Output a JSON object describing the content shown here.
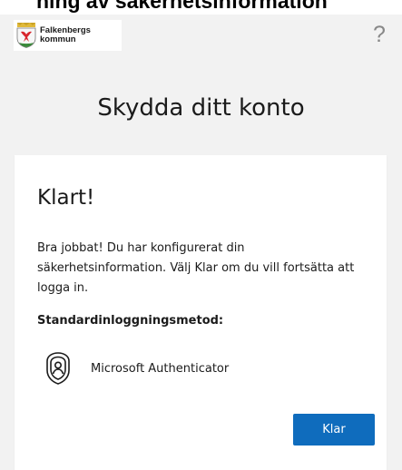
{
  "top_partial_text": "ning av säkerhetsinformation",
  "header": {
    "logo_line1": "Falkenbergs",
    "logo_line2": "kommun",
    "help_glyph": "?"
  },
  "page_title": "Skydda ditt konto",
  "card": {
    "heading": "Klart!",
    "description": "Bra jobbat! Du har konfigurerat din säkerhetsinformation. Välj Klar om du vill fortsätta att logga in.",
    "default_method_label": "Standardinloggningsmetod:",
    "method_icon": "microsoft-authenticator-icon",
    "method_name": "Microsoft Authenticator",
    "done_button_label": "Klar"
  },
  "colors": {
    "page_background": "#f2f2f2",
    "card_background": "#ffffff",
    "primary_button": "#0f6cbd",
    "text": "#1b1b1b",
    "crest_red": "#d8262d",
    "crest_gold": "#c9a227"
  }
}
